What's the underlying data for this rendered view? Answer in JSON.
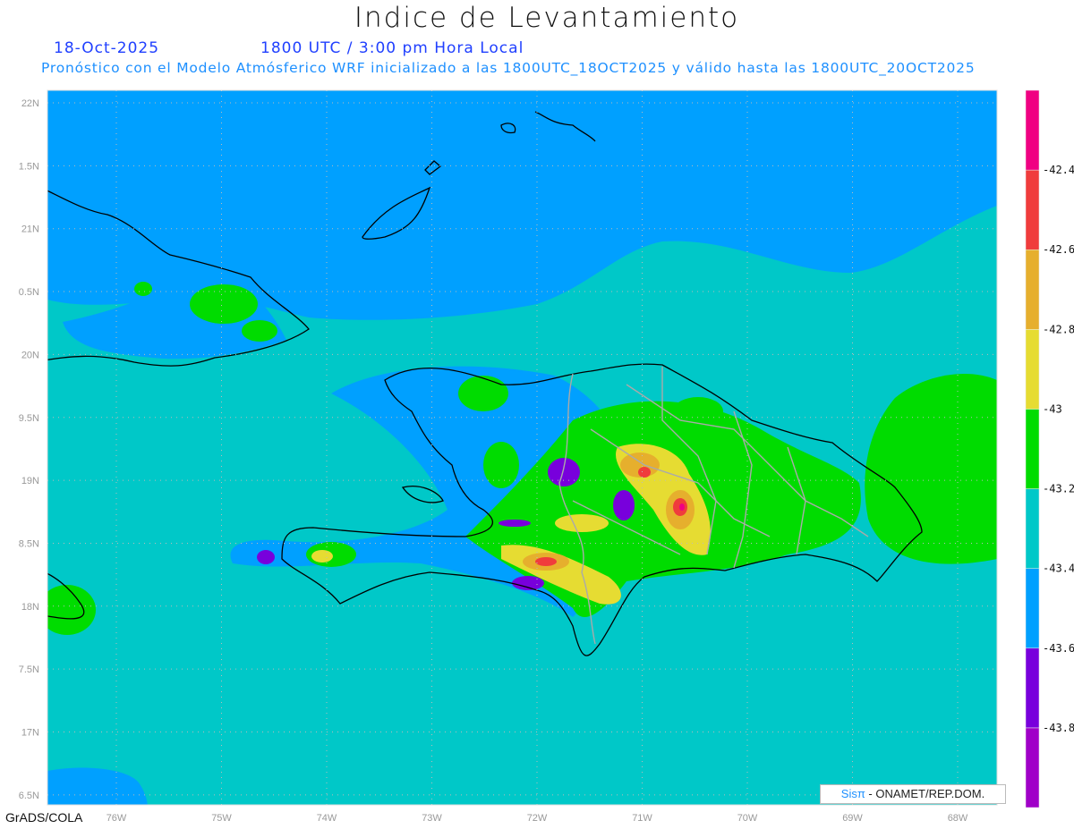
{
  "header": {
    "title": "Indice de Levantamiento",
    "date": "18-Oct-2025",
    "time": "1800 UTC / 3:00 pm Hora Local",
    "description": "Pronóstico con el Modelo Atmósferico WRF inicializado a las 1800UTC_18OCT2025 y válido hasta las  1800UTC_20OCT2025"
  },
  "map": {
    "lon_labels": [
      {
        "value": -76,
        "label": "76W"
      },
      {
        "value": -75,
        "label": "75W"
      },
      {
        "value": -74,
        "label": "74W"
      },
      {
        "value": -73,
        "label": "73W"
      },
      {
        "value": -72,
        "label": "72W"
      },
      {
        "value": -71,
        "label": "71W"
      },
      {
        "value": -70,
        "label": "70W"
      },
      {
        "value": -69,
        "label": "69W"
      },
      {
        "value": -68,
        "label": "68W"
      }
    ],
    "lat_labels": [
      {
        "value": 22,
        "label": "22N"
      },
      {
        "value": 21.5,
        "label": "1.5N"
      },
      {
        "value": 21,
        "label": "21N"
      },
      {
        "value": 20.5,
        "label": "0.5N"
      },
      {
        "value": 20,
        "label": "20N"
      },
      {
        "value": 19.5,
        "label": "9.5N"
      },
      {
        "value": 19,
        "label": "19N"
      },
      {
        "value": 18.5,
        "label": "8.5N"
      },
      {
        "value": 18,
        "label": "18N"
      },
      {
        "value": 17.5,
        "label": "7.5N"
      },
      {
        "value": 17,
        "label": "17N"
      },
      {
        "value": 16.5,
        "label": "6.5N"
      }
    ]
  },
  "colorbar": {
    "colors": [
      "#a000c8",
      "#7800dc",
      "#00a0ff",
      "#00c8c8",
      "#00dc00",
      "#e6dc32",
      "#e6af2d",
      "#f03c3c",
      "#f00082"
    ],
    "labels": [
      "-43.8",
      "-43.6",
      "-43.4",
      "-43.2",
      "-43",
      "-42.8",
      "-42.6",
      "-42.4"
    ]
  },
  "credit": {
    "brand": "Sisπ",
    "text": " - ONAMET/REP.DOM."
  },
  "footer": "GrADS/COLA"
}
